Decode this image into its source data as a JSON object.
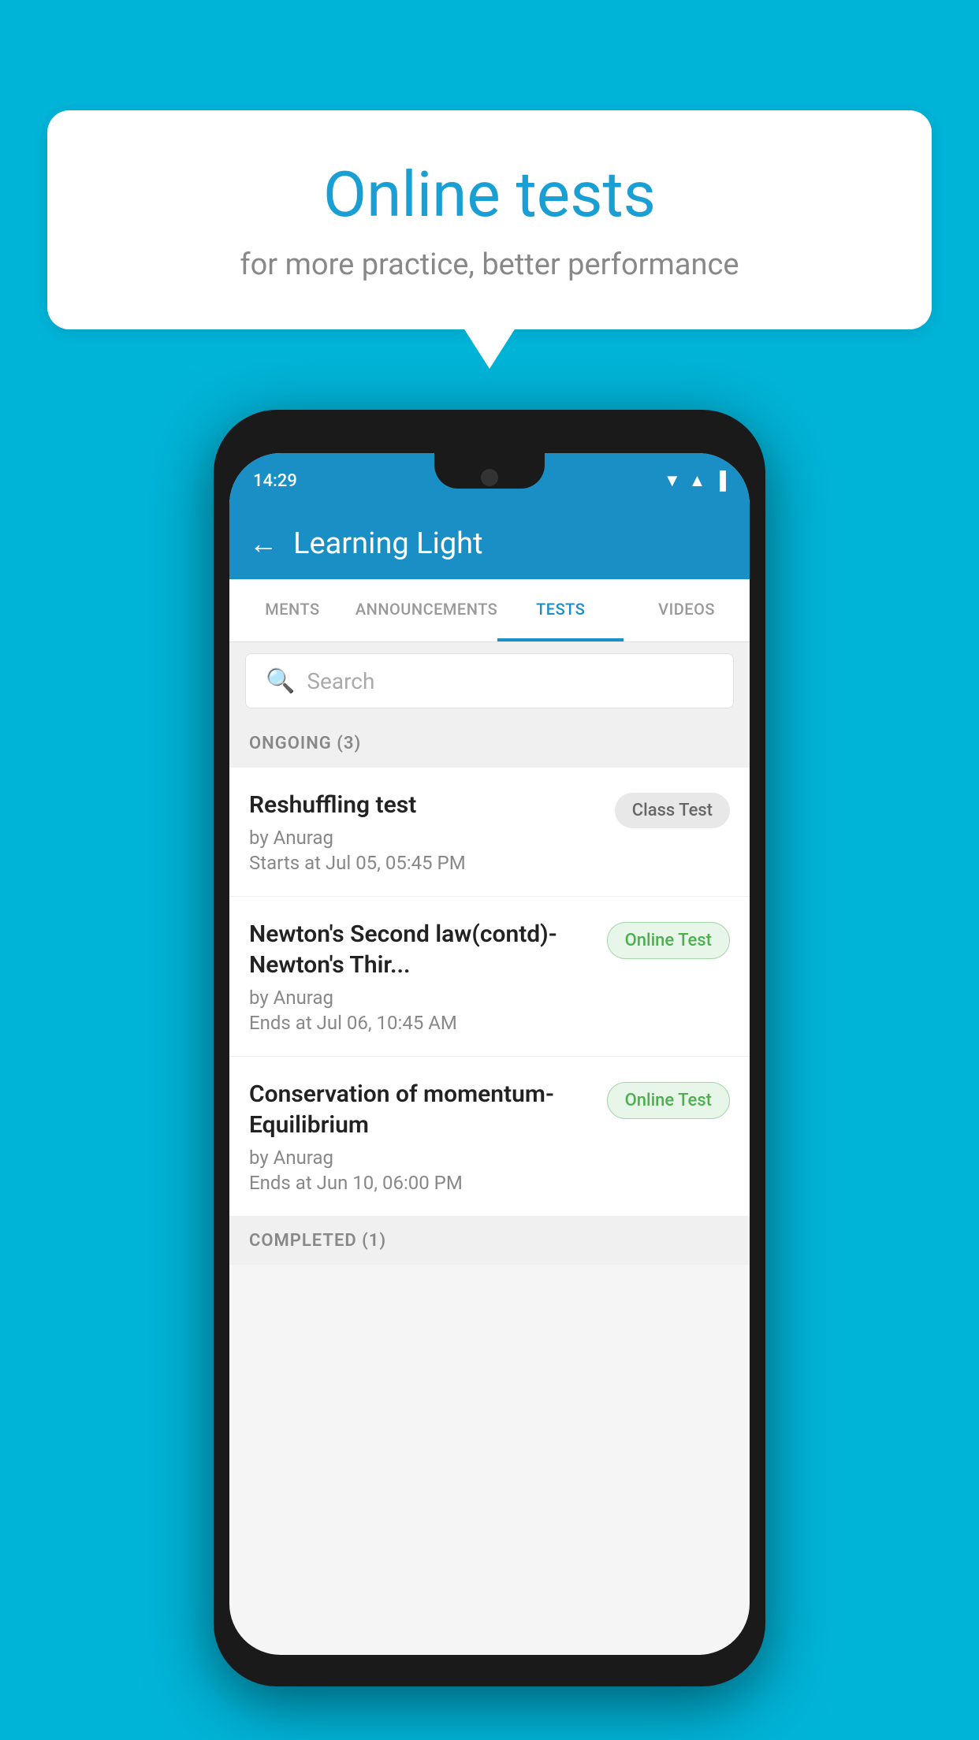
{
  "background": {
    "color": "#00b4d8"
  },
  "speech_bubble": {
    "title": "Online tests",
    "subtitle": "for more practice, better performance"
  },
  "phone": {
    "status_bar": {
      "time": "14:29",
      "icons": [
        "wifi",
        "signal",
        "battery"
      ]
    },
    "header": {
      "back_label": "←",
      "title": "Learning Light"
    },
    "tabs": [
      {
        "label": "MENTS",
        "active": false
      },
      {
        "label": "ANNOUNCEMENTS",
        "active": false
      },
      {
        "label": "TESTS",
        "active": true
      },
      {
        "label": "VIDEOS",
        "active": false
      }
    ],
    "search": {
      "placeholder": "Search"
    },
    "ongoing_section": {
      "label": "ONGOING (3)"
    },
    "test_items": [
      {
        "name": "Reshuffling test",
        "by": "by Anurag",
        "date": "Starts at  Jul 05, 05:45 PM",
        "badge": "Class Test",
        "badge_type": "class"
      },
      {
        "name": "Newton's Second law(contd)-Newton's Thir...",
        "by": "by Anurag",
        "date": "Ends at  Jul 06, 10:45 AM",
        "badge": "Online Test",
        "badge_type": "online"
      },
      {
        "name": "Conservation of momentum-Equilibrium",
        "by": "by Anurag",
        "date": "Ends at  Jun 10, 06:00 PM",
        "badge": "Online Test",
        "badge_type": "online"
      }
    ],
    "completed_section": {
      "label": "COMPLETED (1)"
    }
  }
}
